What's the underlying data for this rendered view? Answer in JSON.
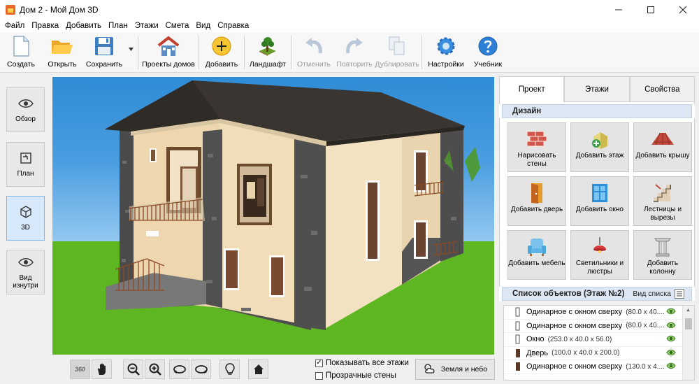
{
  "window": {
    "title": "Дом 2 - Мой Дом 3D",
    "minimize": "—",
    "maximize": "☐",
    "close": "✕"
  },
  "menu": [
    "Файл",
    "Правка",
    "Добавить",
    "План",
    "Этажи",
    "Смета",
    "Вид",
    "Справка"
  ],
  "toolbar": {
    "create": "Создать",
    "open": "Открыть",
    "save": "Сохранить",
    "projects": "Проекты домов",
    "add": "Добавить",
    "landscape": "Ландшафт",
    "undo": "Отменить",
    "redo": "Повторить",
    "duplicate": "Дублировать",
    "settings": "Настройки",
    "tutorial": "Учебник"
  },
  "views": [
    "Обзор",
    "План",
    "3D",
    "Вид изнутри"
  ],
  "active_view": "3D",
  "bottom": {
    "show_all_floors": "Показывать все этажи",
    "show_all_floors_checked": true,
    "transparent_walls": "Прозрачные стены",
    "transparent_walls_checked": false,
    "earth_sky": "Земля и небо",
    "rotate360": "360"
  },
  "panel": {
    "tabs": [
      "Проект",
      "Этажи",
      "Свойства"
    ],
    "active_tab": "Проект",
    "design_header": "Дизайн",
    "design_buttons": [
      {
        "label": "Нарисовать стены",
        "icon": "brick-wall-icon"
      },
      {
        "label": "Добавить этаж",
        "icon": "add-floor-icon"
      },
      {
        "label": "Добавить крышу",
        "icon": "roof-icon"
      },
      {
        "label": "Добавить дверь",
        "icon": "door-icon"
      },
      {
        "label": "Добавить окно",
        "icon": "window-icon"
      },
      {
        "label": "Лестницы и вырезы",
        "icon": "stairs-icon"
      },
      {
        "label": "Добавить мебель",
        "icon": "armchair-icon"
      },
      {
        "label": "Светильники и люстры",
        "icon": "lamp-icon"
      },
      {
        "label": "Добавить колонну",
        "icon": "column-icon"
      }
    ],
    "list_header": "Список объектов (Этаж №2)",
    "list_view": "Вид списка",
    "objects": [
      {
        "name": "Одинарное с окном сверху",
        "dims": "(80.0 x 40...."
      },
      {
        "name": "Одинарное с окном сверху",
        "dims": "(80.0 x 40...."
      },
      {
        "name": "Окно",
        "dims": "(253.0 x 40.0 x 56.0)"
      },
      {
        "name": "Дверь",
        "dims": "(100.0 x 40.0 x 200.0)"
      },
      {
        "name": "Одинарное с окном сверху",
        "dims": "(130.0 x 4...."
      }
    ]
  }
}
